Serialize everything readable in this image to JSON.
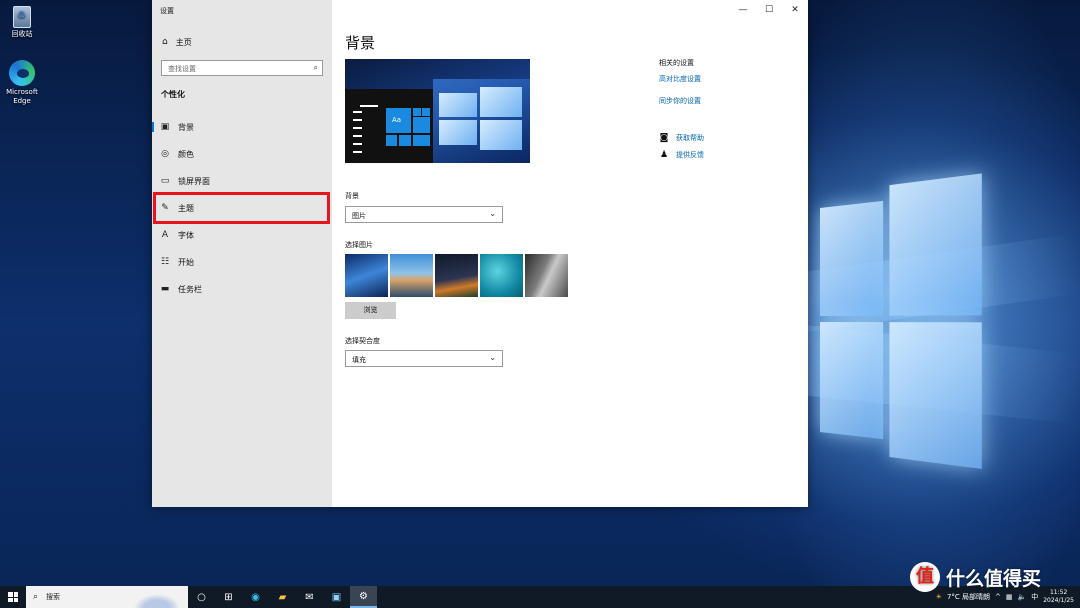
{
  "desktop": {
    "icons": [
      {
        "label": "回收站",
        "icon": "recycle-bin-icon"
      },
      {
        "label": "Microsoft Edge",
        "icon": "edge-icon"
      }
    ]
  },
  "window": {
    "title": "设置",
    "controls": {
      "minimize": "—",
      "maximize": "☐",
      "close": "✕"
    }
  },
  "sidebar": {
    "home_label": "主页",
    "search_placeholder": "查找设置",
    "section": "个性化",
    "items": [
      {
        "label": "背景",
        "icon": "picture-icon",
        "active": true
      },
      {
        "label": "颜色",
        "icon": "palette-icon"
      },
      {
        "label": "锁屏界面",
        "icon": "lock-screen-icon"
      },
      {
        "label": "主题",
        "icon": "theme-icon",
        "highlighted": true
      },
      {
        "label": "字体",
        "icon": "font-icon"
      },
      {
        "label": "开始",
        "icon": "start-icon"
      },
      {
        "label": "任务栏",
        "icon": "taskbar-icon"
      }
    ]
  },
  "main": {
    "title": "背景",
    "preview_tile_text": "Aa",
    "background_label": "背景",
    "background_value": "图片",
    "choose_picture_label": "选择图片",
    "thumbnails": [
      "windows-light",
      "coast-rocks",
      "night-sky",
      "underwater-swimmer",
      "rock-cliff"
    ],
    "browse_label": "浏览",
    "fit_label": "选择契合度",
    "fit_value": "填充"
  },
  "related": {
    "heading": "相关的设置",
    "links": [
      "高对比度设置",
      "同步你的设置"
    ],
    "help": [
      {
        "label": "获取帮助",
        "icon": "help-chat-icon"
      },
      {
        "label": "提供反馈",
        "icon": "feedback-icon"
      }
    ]
  },
  "taskbar": {
    "search_placeholder": "搜索",
    "weather": "7°C 局部晴朗",
    "ime": "中",
    "time": "11:52",
    "date": "2024/1/25"
  },
  "watermark": {
    "badge": "值",
    "text": "什么值得买"
  },
  "colors": {
    "accent": "#0078d7",
    "highlight_border": "#e8131c",
    "link": "#0063b1",
    "sidebar_bg": "#e6e6e6",
    "taskbar_bg": "#101a26"
  }
}
